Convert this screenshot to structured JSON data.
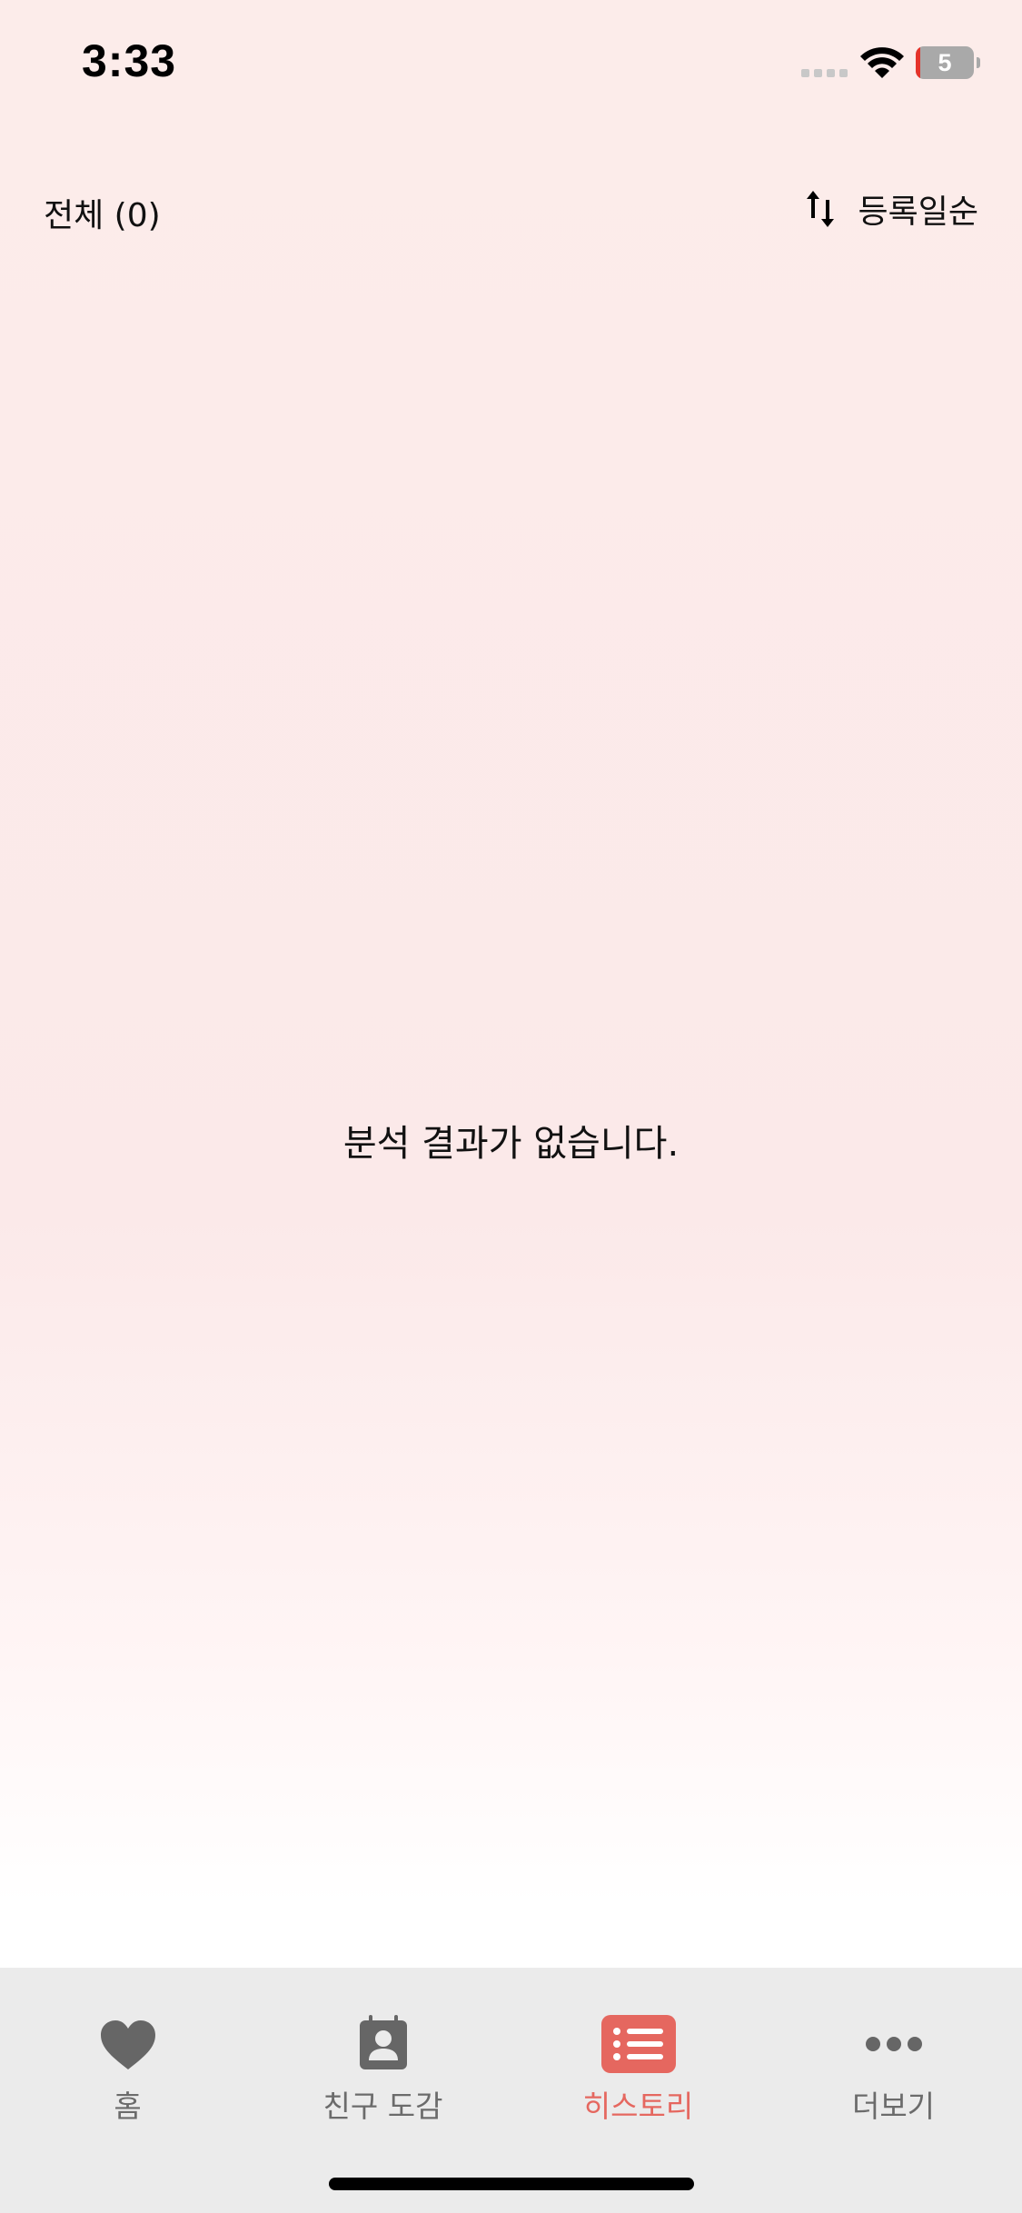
{
  "status_bar": {
    "time": "3:33",
    "battery_level": "5",
    "icons": [
      "signal-dots-icon",
      "wifi-icon",
      "battery-icon"
    ]
  },
  "header": {
    "filter_label": "전체 (0)",
    "sort_label": "등록일순",
    "sort_icon": "sort-arrows-icon"
  },
  "main": {
    "empty_message": "분석 결과가 없습니다."
  },
  "tab_bar": {
    "active_color": "#e5675f",
    "inactive_color": "#6b6b6b",
    "tabs": [
      {
        "label": "홈",
        "icon": "heart-icon",
        "active": false
      },
      {
        "label": "친구 도감",
        "icon": "contact-book-icon",
        "active": false
      },
      {
        "label": "히스토리",
        "icon": "list-icon",
        "active": true
      },
      {
        "label": "더보기",
        "icon": "more-dots-icon",
        "active": false
      }
    ]
  }
}
